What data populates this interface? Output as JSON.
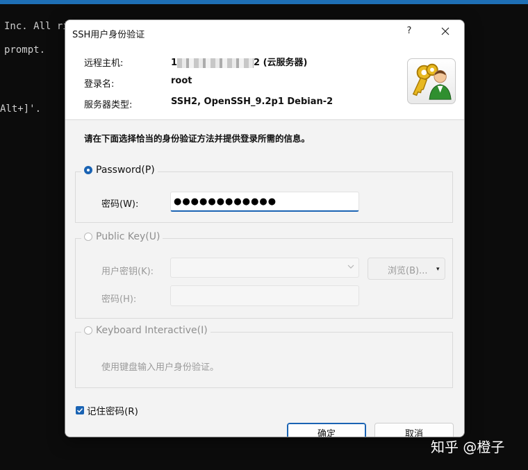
{
  "terminal": {
    "line1": "Inc. All ri",
    "line2": "prompt.",
    "line3": "Alt+]'."
  },
  "dialog": {
    "title": "SSH用户身份验证",
    "help_label": "?",
    "host_label": "远程主机:",
    "host_value_suffix": "2 (云服务器)",
    "user_label": "登录名:",
    "user_value": "root",
    "server_type_label": "服务器类型:",
    "server_type_value": "SSH2, OpenSSH_9.2p1 Debian-2",
    "instruction": "请在下面选择恰当的身份验证方法并提供登录所需的信息。",
    "password_section": {
      "radio_label": "Password(P)",
      "selected": true,
      "field_label": "密码(W):",
      "field_value": "●●●●●●●●●●●●"
    },
    "pubkey_section": {
      "radio_label": "Public Key(U)",
      "selected": false,
      "userkey_label": "用户密钥(K):",
      "browse_label": "浏览(B)...",
      "passphrase_label": "密码(H):"
    },
    "kbd_section": {
      "radio_label": "Keyboard Interactive(I)",
      "selected": false,
      "hint": "使用键盘输入用户身份验证。"
    },
    "remember_label": "记住密码(R)",
    "remember_checked": true,
    "ok_label": "确定",
    "cancel_label": "取消"
  },
  "watermark": "知乎 @橙子",
  "colors": {
    "accent": "#1a63b3",
    "terminal_bg": "#0c0c0c"
  }
}
